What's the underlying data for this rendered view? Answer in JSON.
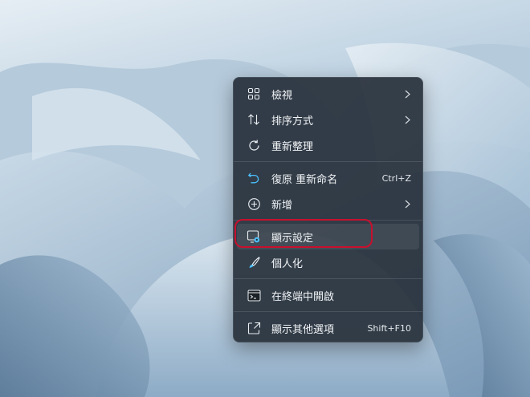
{
  "desktop": {
    "wallpaper": "windows-11-bloom-light-blue"
  },
  "context_menu": {
    "items": [
      {
        "label": "檢視",
        "icon": "view-grid-icon",
        "submenu": true
      },
      {
        "label": "排序方式",
        "icon": "sort-arrows-icon",
        "submenu": true
      },
      {
        "label": "重新整理",
        "icon": "refresh-icon",
        "submenu": false
      },
      {
        "label": "復原 重新命名",
        "icon": "undo-icon",
        "shortcut": "Ctrl+Z",
        "submenu": false
      },
      {
        "label": "新增",
        "icon": "add-circle-icon",
        "submenu": true
      },
      {
        "label": "顯示設定",
        "icon": "display-settings-icon",
        "submenu": false,
        "highlighted": true
      },
      {
        "label": "個人化",
        "icon": "brush-icon",
        "submenu": false
      },
      {
        "label": "在終端中開啟",
        "icon": "terminal-icon",
        "submenu": false
      },
      {
        "label": "顯示其他選項",
        "icon": "more-options-icon",
        "shortcut": "Shift+F10",
        "submenu": false
      }
    ]
  },
  "colors": {
    "menu_bg": "#28323c",
    "menu_text": "#f2f4f6",
    "accent_icon": "#4cc2ff",
    "annotation_ring": "#c8102e"
  }
}
